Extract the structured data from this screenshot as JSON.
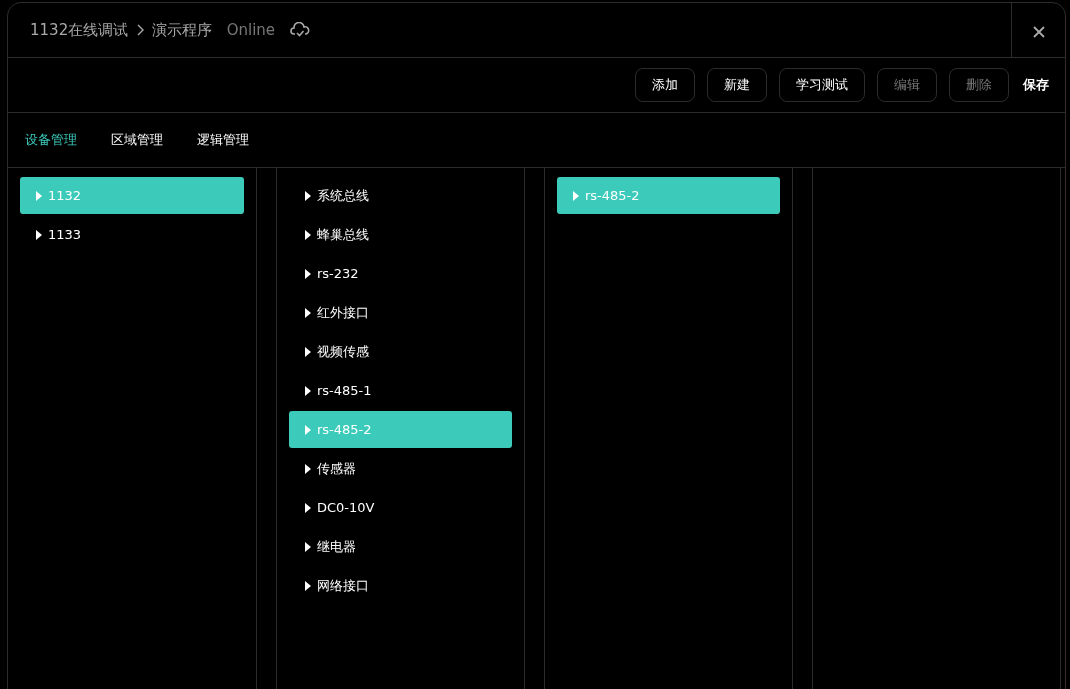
{
  "header": {
    "breadcrumb": [
      "1132在线调试",
      "演示程序"
    ],
    "status": "Online"
  },
  "toolbar": {
    "buttons": [
      {
        "label": "添加",
        "disabled": false,
        "kind": "outlined"
      },
      {
        "label": "新建",
        "disabled": false,
        "kind": "outlined"
      },
      {
        "label": "学习测试",
        "disabled": false,
        "kind": "outlined"
      },
      {
        "label": "编辑",
        "disabled": true,
        "kind": "outlined"
      },
      {
        "label": "删除",
        "disabled": true,
        "kind": "outlined"
      },
      {
        "label": "保存",
        "disabled": false,
        "kind": "plain"
      }
    ]
  },
  "tabs": [
    {
      "label": "设备管理",
      "selected": true
    },
    {
      "label": "区域管理",
      "selected": false
    },
    {
      "label": "逻辑管理",
      "selected": false
    }
  ],
  "columns": [
    {
      "items": [
        {
          "label": "1132",
          "selected": true
        },
        {
          "label": "1133",
          "selected": false
        }
      ]
    },
    {
      "items": [
        {
          "label": "系统总线",
          "selected": false
        },
        {
          "label": "蜂巢总线",
          "selected": false
        },
        {
          "label": "rs-232",
          "selected": false
        },
        {
          "label": "红外接口",
          "selected": false
        },
        {
          "label": "视频传感",
          "selected": false
        },
        {
          "label": "rs-485-1",
          "selected": false
        },
        {
          "label": "rs-485-2",
          "selected": true
        },
        {
          "label": "传感器",
          "selected": false
        },
        {
          "label": "DC0-10V",
          "selected": false
        },
        {
          "label": "继电器",
          "selected": false
        },
        {
          "label": "网络接口",
          "selected": false
        }
      ]
    },
    {
      "items": [
        {
          "label": "rs-485-2",
          "selected": true
        }
      ]
    }
  ]
}
